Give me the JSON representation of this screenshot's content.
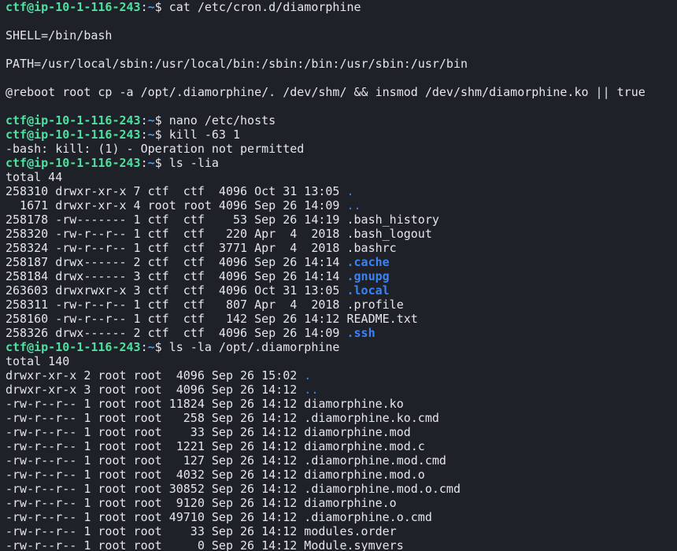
{
  "colors": {
    "background": "#1e2127",
    "foreground": "#e4e6ea",
    "prompt_user": "#4fe0a0",
    "prompt_path": "#46a0ff",
    "directory": "#3b82f6"
  },
  "prompt": {
    "user_host": "ctf@ip-10-1-116-243",
    "colon": ":",
    "path": "~",
    "symbol": "$ "
  },
  "lines": [
    {
      "type": "prompt",
      "command": "cat /etc/cron.d/diamorphine"
    },
    {
      "type": "text",
      "text": ""
    },
    {
      "type": "text",
      "text": "SHELL=/bin/bash"
    },
    {
      "type": "text",
      "text": ""
    },
    {
      "type": "text",
      "text": "PATH=/usr/local/sbin:/usr/local/bin:/sbin:/bin:/usr/sbin:/usr/bin"
    },
    {
      "type": "text",
      "text": ""
    },
    {
      "type": "text",
      "text": "@reboot root cp -a /opt/.diamorphine/. /dev/shm/ && insmod /dev/shm/diamorphine.ko || true"
    },
    {
      "type": "text",
      "text": ""
    },
    {
      "type": "prompt",
      "command": "nano /etc/hosts"
    },
    {
      "type": "prompt",
      "command": "kill -63 1"
    },
    {
      "type": "text",
      "text": "-bash: kill: (1) - Operation not permitted"
    },
    {
      "type": "prompt",
      "command": "ls -lia"
    },
    {
      "type": "text",
      "text": "total 44"
    },
    {
      "type": "entry",
      "prefix": "258310 drwxr-xr-x 7 ctf  ctf  4096 Oct 31 13:05 ",
      "name": ".",
      "kind": "dot"
    },
    {
      "type": "entry",
      "prefix": "  1671 drwxr-xr-x 4 root root 4096 Sep 26 14:09 ",
      "name": "..",
      "kind": "dot"
    },
    {
      "type": "entry",
      "prefix": "258178 -rw------- 1 ctf  ctf    53 Sep 26 14:19 ",
      "name": ".bash_history",
      "kind": "file"
    },
    {
      "type": "entry",
      "prefix": "258320 -rw-r--r-- 1 ctf  ctf   220 Apr  4  2018 ",
      "name": ".bash_logout",
      "kind": "file"
    },
    {
      "type": "entry",
      "prefix": "258324 -rw-r--r-- 1 ctf  ctf  3771 Apr  4  2018 ",
      "name": ".bashrc",
      "kind": "file"
    },
    {
      "type": "entry",
      "prefix": "258187 drwx------ 2 ctf  ctf  4096 Sep 26 14:14 ",
      "name": ".cache",
      "kind": "dir"
    },
    {
      "type": "entry",
      "prefix": "258184 drwx------ 3 ctf  ctf  4096 Sep 26 14:14 ",
      "name": ".gnupg",
      "kind": "dir"
    },
    {
      "type": "entry",
      "prefix": "263603 drwxrwxr-x 3 ctf  ctf  4096 Oct 31 13:05 ",
      "name": ".local",
      "kind": "dir"
    },
    {
      "type": "entry",
      "prefix": "258311 -rw-r--r-- 1 ctf  ctf   807 Apr  4  2018 ",
      "name": ".profile",
      "kind": "file"
    },
    {
      "type": "entry",
      "prefix": "258160 -rw-r--r-- 1 ctf  ctf   142 Sep 26 14:12 ",
      "name": "README.txt",
      "kind": "file"
    },
    {
      "type": "entry",
      "prefix": "258326 drwx------ 2 ctf  ctf  4096 Sep 26 14:09 ",
      "name": ".ssh",
      "kind": "dir"
    },
    {
      "type": "prompt",
      "command": "ls -la /opt/.diamorphine"
    },
    {
      "type": "text",
      "text": "total 140"
    },
    {
      "type": "entry",
      "prefix": "drwxr-xr-x 2 root root  4096 Sep 26 15:02 ",
      "name": ".",
      "kind": "dot"
    },
    {
      "type": "entry",
      "prefix": "drwxr-xr-x 3 root root  4096 Sep 26 14:12 ",
      "name": "..",
      "kind": "dot"
    },
    {
      "type": "entry",
      "prefix": "-rw-r--r-- 1 root root 11824 Sep 26 14:12 ",
      "name": "diamorphine.ko",
      "kind": "file"
    },
    {
      "type": "entry",
      "prefix": "-rw-r--r-- 1 root root   258 Sep 26 14:12 ",
      "name": ".diamorphine.ko.cmd",
      "kind": "file"
    },
    {
      "type": "entry",
      "prefix": "-rw-r--r-- 1 root root    33 Sep 26 14:12 ",
      "name": "diamorphine.mod",
      "kind": "file"
    },
    {
      "type": "entry",
      "prefix": "-rw-r--r-- 1 root root  1221 Sep 26 14:12 ",
      "name": "diamorphine.mod.c",
      "kind": "file"
    },
    {
      "type": "entry",
      "prefix": "-rw-r--r-- 1 root root   127 Sep 26 14:12 ",
      "name": ".diamorphine.mod.cmd",
      "kind": "file"
    },
    {
      "type": "entry",
      "prefix": "-rw-r--r-- 1 root root  4032 Sep 26 14:12 ",
      "name": "diamorphine.mod.o",
      "kind": "file"
    },
    {
      "type": "entry",
      "prefix": "-rw-r--r-- 1 root root 30852 Sep 26 14:12 ",
      "name": ".diamorphine.mod.o.cmd",
      "kind": "file"
    },
    {
      "type": "entry",
      "prefix": "-rw-r--r-- 1 root root  9120 Sep 26 14:12 ",
      "name": "diamorphine.o",
      "kind": "file"
    },
    {
      "type": "entry",
      "prefix": "-rw-r--r-- 1 root root 49710 Sep 26 14:12 ",
      "name": ".diamorphine.o.cmd",
      "kind": "file"
    },
    {
      "type": "entry",
      "prefix": "-rw-r--r-- 1 root root    33 Sep 26 14:12 ",
      "name": "modules.order",
      "kind": "file"
    },
    {
      "type": "entry",
      "prefix": "-rw-r--r-- 1 root root     0 Sep 26 14:12 ",
      "name": "Module.symvers",
      "kind": "file"
    }
  ]
}
